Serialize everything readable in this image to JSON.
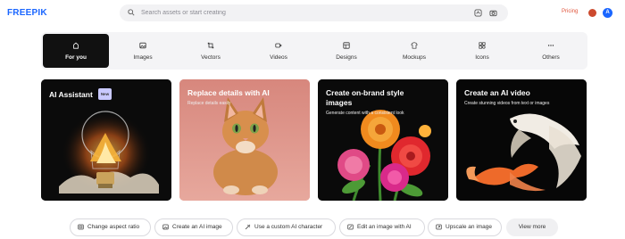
{
  "header": {
    "logo": "FREEPIK",
    "search_placeholder": "Search assets or start creating",
    "pricing": "Pricing",
    "avatar_initial": "A"
  },
  "tabs": [
    {
      "label": "For you",
      "icon": "home-icon",
      "active": true
    },
    {
      "label": "Images",
      "icon": "image-icon"
    },
    {
      "label": "Vectors",
      "icon": "vector-icon"
    },
    {
      "label": "Videos",
      "icon": "video-icon"
    },
    {
      "label": "Designs",
      "icon": "design-icon"
    },
    {
      "label": "Mockups",
      "icon": "mockup-icon"
    },
    {
      "label": "Icons",
      "icon": "icons-icon"
    },
    {
      "label": "Others",
      "icon": "more-icon"
    }
  ],
  "cards": [
    {
      "title": "AI Assistant",
      "badge": "New",
      "subtitle": "",
      "image": "lightbulb-image"
    },
    {
      "title": "Replace details with AI",
      "subtitle": "Replace details easily",
      "image": "cat-image"
    },
    {
      "title_line1": "Create on-brand style",
      "title_line2": "images",
      "subtitle": "Generate content with a consistent look",
      "image": "flowers-image"
    },
    {
      "title": "Create an AI video",
      "subtitle": "Create stunning videos from text or images",
      "image": "fish-image"
    }
  ],
  "actions": [
    {
      "label": "Change aspect ratio",
      "icon": "aspect-ratio-icon"
    },
    {
      "label": "Create an AI image",
      "icon": "ai-image-icon"
    },
    {
      "label": "Use a custom AI character",
      "icon": "character-icon"
    },
    {
      "label": "Edit an image with AI",
      "icon": "edit-image-icon"
    },
    {
      "label": "Upscale an image",
      "icon": "upscale-icon"
    },
    {
      "label": "View more",
      "icon": ""
    }
  ],
  "colors": {
    "brand": "#1a66ff",
    "pricing": "#e0543b",
    "active_tab": "#111111"
  }
}
